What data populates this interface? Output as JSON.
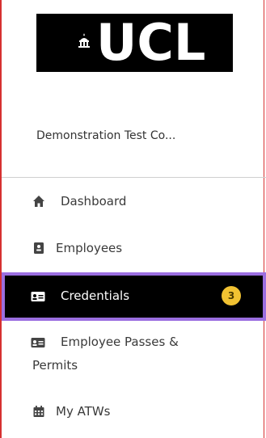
{
  "logo": {
    "text": "UCL",
    "alt": "UCL logo"
  },
  "organization": {
    "name": "Demonstration Test Co..."
  },
  "nav": {
    "items": [
      {
        "label": "Dashboard",
        "icon": "home-icon"
      },
      {
        "label": "Employees",
        "icon": "id-badge-icon"
      },
      {
        "label": "Credentials",
        "icon": "id-card-icon",
        "badge": "3"
      },
      {
        "label_line1": "Employee Passes &",
        "label_line2": "Permits",
        "icon": "id-card-icon"
      },
      {
        "label": "My ATWs",
        "icon": "calendar-icon"
      }
    ]
  },
  "colors": {
    "active_bg": "#000000",
    "active_outline": "#9b6ee0",
    "badge_bg": "#f1c232",
    "frame_border": "#d63030"
  }
}
